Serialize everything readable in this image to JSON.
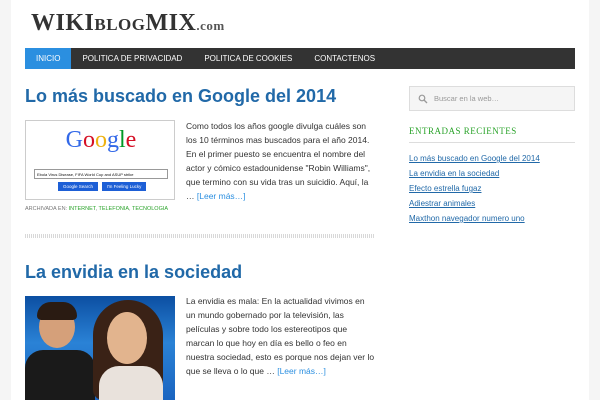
{
  "header": {
    "logo_wiki": "WIKI",
    "logo_blog": "BLOG",
    "logo_mix": "MIX",
    "logo_dotcom": ".com"
  },
  "nav": {
    "items": [
      "INICIO",
      "POLITICA DE PRIVACIDAD",
      "POLITICA DE COOKIES",
      "CONTACTENOS"
    ],
    "active_index": 0
  },
  "posts": [
    {
      "title": "Lo más buscado en Google del 2014",
      "excerpt": "Como todos los años google divulga cuáles son los 10 términos mas buscados para el año 2014. En el primer puesto se encuentra el nombre del actor y cómico estadounidense \"Robin Williams\", que termino con su vida tras un suicidio. Aquí, la …",
      "more": "[Leer más…]",
      "archived_label": "ARCHIVADA EN:",
      "categories": [
        "INTERNET",
        "TELEFONIA",
        "TECNOLOGIA"
      ],
      "thumb": {
        "logo_letters": [
          "G",
          "o",
          "o",
          "g",
          "l",
          "e"
        ],
        "search_text": "Ebola Virus Disease, FIFA World Cup and ASUP strike",
        "btn_search": "Google Search",
        "btn_lucky": "I'm Feeling Lucky"
      }
    },
    {
      "title": "La envidia en la sociedad",
      "excerpt": "La envidia es mala: En la actualidad vivimos en un mundo gobernado por la televisión, las películas y sobre todo los estereotipos que marcan lo que hoy en día es bello o feo en nuestra sociedad, esto es porque nos dejan ver lo que se lleva o lo que …",
      "more": "[Leer más…]"
    }
  ],
  "sidebar": {
    "search_placeholder": "Buscar en la web…",
    "recent_title": "ENTRADAS RECIENTES",
    "recent": [
      "Lo más buscado en Google del 2014",
      "La envidia en la sociedad",
      "Efecto estrella fugaz",
      "Adiestrar animales",
      "Maxthon navegador numero uno"
    ]
  },
  "colors": {
    "accent_blue": "#2b8fe0",
    "title_blue": "#2169a8",
    "category_green": "#2aa32a",
    "nav_dark": "#333333"
  }
}
